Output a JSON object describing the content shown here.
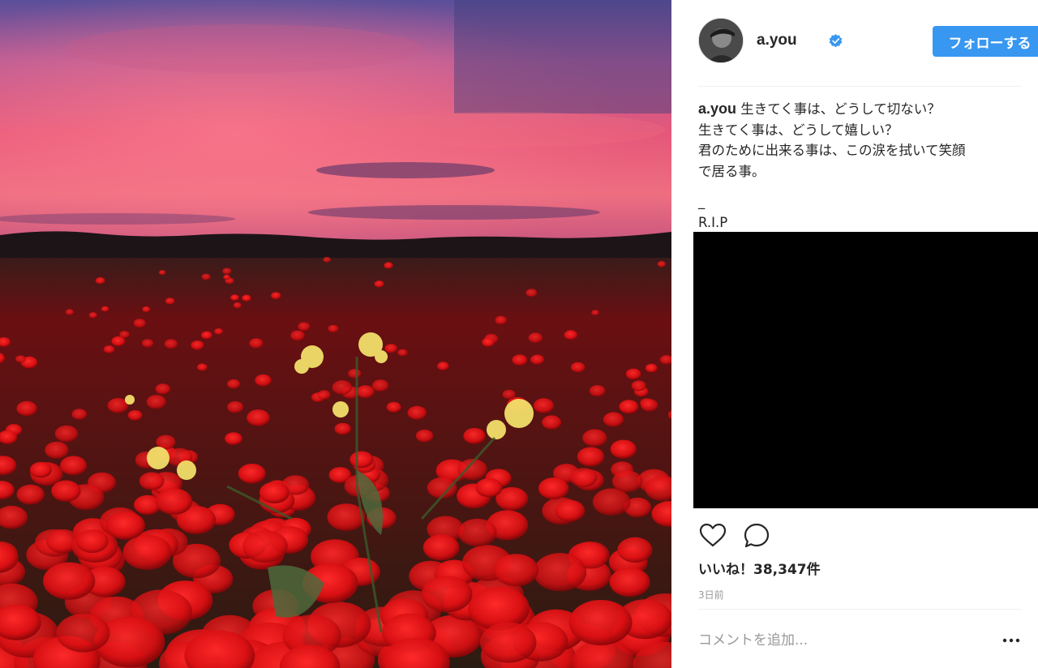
{
  "post": {
    "username": "a.you",
    "verified": true,
    "follow_label": "フォローする",
    "caption": {
      "user": "a.you",
      "first_line": "生きてく事は、どうして切ない？",
      "lines": [
        "生きてく事は、どうして嬉しい？",
        "君のために出来る事は、この涙を拭いて笑顔",
        "で居る事。"
      ],
      "dash": "_",
      "tag": "R.I.P"
    },
    "likes_text": "いいね！38,347件",
    "time_ago": "3日前",
    "comment_placeholder": "コメントを追加...",
    "icons": {
      "like": "heart-icon",
      "comment": "comment-icon",
      "more": "more-dots-icon",
      "verified": "verified-badge-icon"
    },
    "colors": {
      "accent": "#3897f0",
      "text": "#262626",
      "muted": "#999999"
    }
  }
}
